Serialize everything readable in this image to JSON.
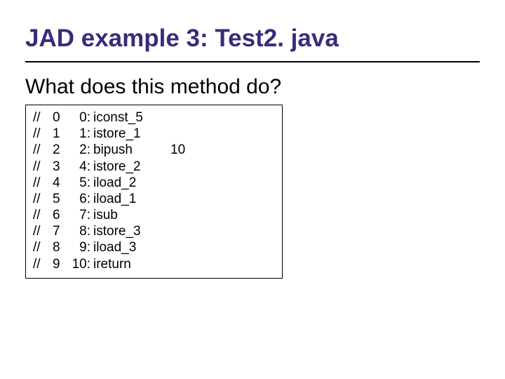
{
  "title": "JAD example 3: Test2. java",
  "subtitle": "What does this method do?",
  "code": {
    "rows": [
      {
        "prefix": "//",
        "idx": "0",
        "offset": "0:",
        "opcode": "iconst_5",
        "operand": ""
      },
      {
        "prefix": "//",
        "idx": "1",
        "offset": "1:",
        "opcode": "istore_1",
        "operand": ""
      },
      {
        "prefix": "//",
        "idx": "2",
        "offset": "2:",
        "opcode": "bipush",
        "operand": "10"
      },
      {
        "prefix": "//",
        "idx": "3",
        "offset": "4:",
        "opcode": "istore_2",
        "operand": ""
      },
      {
        "prefix": "//",
        "idx": "4",
        "offset": "5:",
        "opcode": "iload_2",
        "operand": ""
      },
      {
        "prefix": "//",
        "idx": "5",
        "offset": "6:",
        "opcode": "iload_1",
        "operand": ""
      },
      {
        "prefix": "//",
        "idx": "6",
        "offset": "7:",
        "opcode": "isub",
        "operand": ""
      },
      {
        "prefix": "//",
        "idx": "7",
        "offset": "8:",
        "opcode": "istore_3",
        "operand": ""
      },
      {
        "prefix": "//",
        "idx": "8",
        "offset": "9:",
        "opcode": "iload_3",
        "operand": ""
      },
      {
        "prefix": "//",
        "idx": "9",
        "offset": "10:",
        "opcode": "ireturn",
        "operand": ""
      }
    ]
  }
}
